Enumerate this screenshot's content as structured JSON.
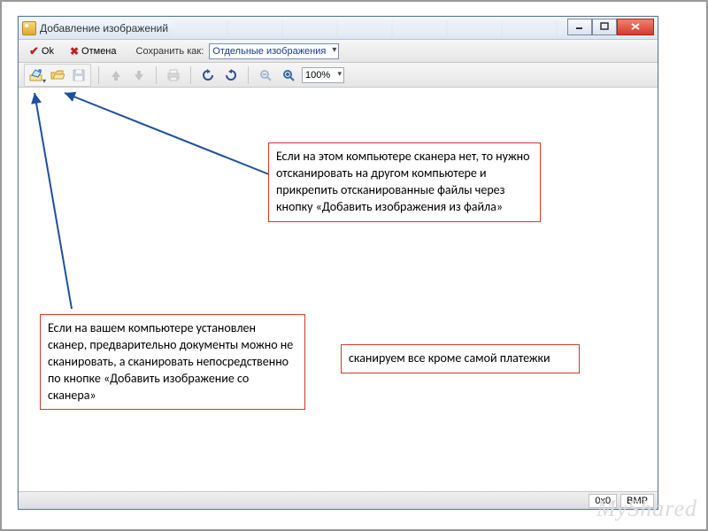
{
  "window": {
    "title": "Добавление изображений"
  },
  "toolbar1": {
    "ok_label": "Ok",
    "cancel_label": "Отмена",
    "save_as_label": "Сохранить как:",
    "save_as_value": "Отдельные изображения"
  },
  "toolbar2": {
    "zoom_value": "100%"
  },
  "annotations": {
    "no_scanner": "Если на этом компьютере сканера нет, то нужно отсканировать на другом компьютере и прикрепить отсканированные файлы через кнопку «Добавить изображения из файла»",
    "has_scanner": "Если на вашем компьютере установлен сканер, предварительно документы можно не сканировать, а сканировать непосредственно по кнопке «Добавить изображение со сканера»",
    "scan_all": "сканируем все кроме самой платежки"
  },
  "statusbar": {
    "dimensions": "0x0",
    "format": "BMP"
  },
  "watermark": "MyShared"
}
